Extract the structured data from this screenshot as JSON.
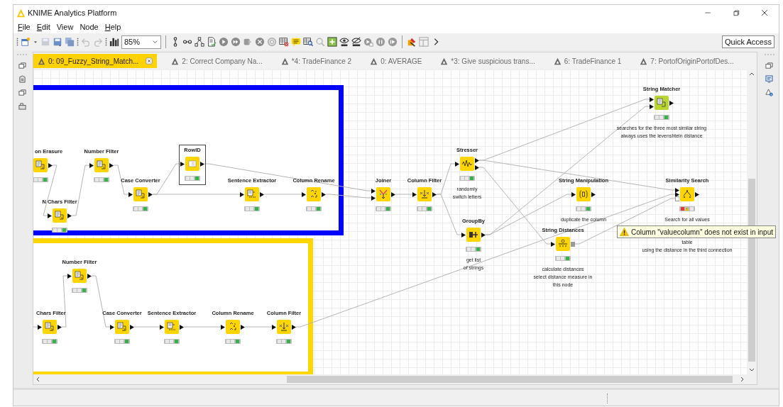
{
  "window": {
    "title": "KNIME Analytics Platform"
  },
  "menu": [
    {
      "label": "File",
      "mnemonic": true
    },
    {
      "label": "Edit",
      "mnemonic": true
    },
    {
      "label": "View",
      "mnemonic": false
    },
    {
      "label": "Node",
      "mnemonic": false
    },
    {
      "label": "Help",
      "mnemonic": true
    }
  ],
  "toolbar": {
    "zoom": "85%",
    "quick_access": "Quick Access"
  },
  "tabs": [
    {
      "label": "0: 09_Fuzzy_String_Match...",
      "selected": true
    },
    {
      "label": "2: Correct Company Na...",
      "selected": false
    },
    {
      "label": "*4: TradeFinance 2",
      "selected": false
    },
    {
      "label": "0: AVERAGE",
      "selected": false
    },
    {
      "label": "*3: Give suspicious trans...",
      "selected": false
    },
    {
      "label": "6: TradeFinance 1",
      "selected": false
    },
    {
      "label": "7: PortofOriginPortofDes...",
      "selected": false
    }
  ],
  "workflow": {
    "annotations": [
      {
        "color": "#0000ff"
      },
      {
        "color": "#ffd700"
      }
    ],
    "nodes": [
      {
        "label": "on Erasure",
        "kind": "text-processing",
        "executed": true,
        "failed": false,
        "selected": false
      },
      {
        "label": "Number Filter",
        "kind": "text-processing",
        "executed": true,
        "failed": false,
        "selected": false
      },
      {
        "label": "N Chars Filter",
        "kind": "text-processing",
        "executed": true,
        "failed": false,
        "selected": false
      },
      {
        "label": "Case Converter",
        "kind": "text-processing",
        "executed": true,
        "failed": false,
        "selected": false
      },
      {
        "label": "RowID",
        "kind": "rowid",
        "executed": true,
        "failed": false,
        "selected": true
      },
      {
        "label": "Sentence Extractor",
        "kind": "sentence-extractor",
        "executed": true,
        "failed": false,
        "selected": false
      },
      {
        "label": "Column Rename",
        "kind": "column-rename",
        "executed": true,
        "failed": false,
        "selected": false
      },
      {
        "label": "Joiner",
        "kind": "joiner",
        "executed": true,
        "failed": false,
        "selected": false
      },
      {
        "label": "Column Filter",
        "kind": "column-filter",
        "executed": true,
        "failed": false,
        "selected": false
      },
      {
        "label": "Stresser",
        "kind": "stresser",
        "executed": true,
        "failed": false,
        "selected": false,
        "note": [
          "randomly",
          "switch letters"
        ]
      },
      {
        "label": "GroupBy",
        "kind": "groupby",
        "executed": true,
        "failed": false,
        "selected": false,
        "note": [
          "get list",
          "of strings"
        ]
      },
      {
        "label": "String Matcher",
        "kind": "string-matcher",
        "executed": true,
        "failed": false,
        "selected": false,
        "note": [
          "searches for the three most similar string",
          "always uses the levenshtein distance"
        ]
      },
      {
        "label": "String Manipulation",
        "kind": "string-manipulation",
        "executed": true,
        "failed": false,
        "selected": false,
        "note": [
          "duplicate the column"
        ]
      },
      {
        "label": "String Distances",
        "kind": "string-distances",
        "executed": true,
        "failed": false,
        "selected": false,
        "note": [
          "calculate distances",
          "select distance measure in",
          "this node"
        ]
      },
      {
        "label": "Similarity Search",
        "kind": "similarity-search",
        "executed": false,
        "failed": true,
        "selected": false,
        "note": [
          "Search for all values",
          "table",
          "using the distance in the third connection"
        ]
      },
      {
        "label": "Number Filter",
        "kind": "text-processing",
        "executed": true,
        "failed": false,
        "selected": false
      },
      {
        "label": "Chars Filter",
        "kind": "text-processing",
        "executed": true,
        "failed": false,
        "selected": false
      },
      {
        "label": "Case Converter",
        "kind": "text-processing",
        "executed": true,
        "failed": false,
        "selected": false
      },
      {
        "label": "Sentence Extractor",
        "kind": "sentence-extractor",
        "executed": true,
        "failed": false,
        "selected": false
      },
      {
        "label": "Column Rename",
        "kind": "column-rename",
        "executed": true,
        "failed": false,
        "selected": false
      },
      {
        "label": "Column Filter",
        "kind": "column-filter",
        "executed": true,
        "failed": false,
        "selected": false
      }
    ],
    "tooltip": {
      "text": "Column \"valuecolumn\" does not exist in input"
    }
  }
}
